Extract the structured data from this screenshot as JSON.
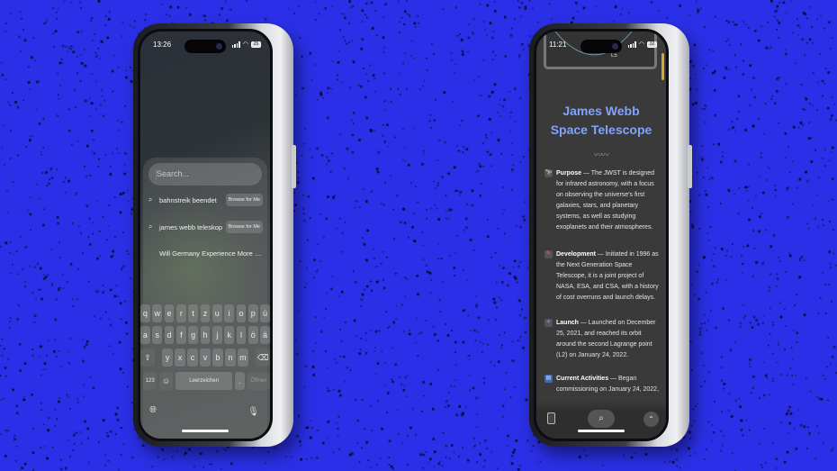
{
  "background_color": "#2b30e8",
  "left_phone": {
    "status": {
      "time": "13:26",
      "battery": "25"
    },
    "search": {
      "placeholder": "Search..."
    },
    "suggestions": [
      {
        "icon": "search-icon",
        "text": "bahnstreik beendet",
        "action": "Browse for Me"
      },
      {
        "icon": "search-icon",
        "text": "james webb teleskop",
        "action": "Browse for Me"
      },
      {
        "icon": "loading-icon",
        "text": "Will Germany Experience More Rail Stri..."
      }
    ],
    "keyboard": {
      "row1": [
        "q",
        "w",
        "e",
        "r",
        "t",
        "z",
        "u",
        "i",
        "o",
        "p",
        "ü"
      ],
      "row2": [
        "a",
        "s",
        "d",
        "f",
        "g",
        "h",
        "j",
        "k",
        "l",
        "ö",
        "ä"
      ],
      "row3": [
        "y",
        "x",
        "c",
        "v",
        "b",
        "n",
        "m"
      ],
      "numbers": "123",
      "space": "Leerzeichen",
      "period": ".",
      "return": "Öffnen"
    }
  },
  "right_phone": {
    "status": {
      "time": "11:21",
      "battery": "32"
    },
    "diagram_label": "L5",
    "title": "James Webb Space Telescope",
    "sections": [
      {
        "heading": "Purpose",
        "text": " — The JWST is designed for infrared astronomy, with a focus on observing the universe's first galaxies, stars, and planetary systems, as well as studying exoplanets and their atmospheres."
      },
      {
        "heading": "Development",
        "text": " — Initiated in 1996 as the Next Generation Space Telescope, it is a joint project of NASA, ESA, and CSA, with a history of cost overruns and launch delays."
      },
      {
        "heading": "Launch",
        "text": " — Launched on December 25, 2021, and reached its orbit around the second Lagrange point (L2) on January 24, 2022."
      },
      {
        "heading": "Current Activities",
        "text": " — Began commissioning on January 24, 2022,"
      }
    ],
    "accent_color": "#7fa4ff"
  }
}
